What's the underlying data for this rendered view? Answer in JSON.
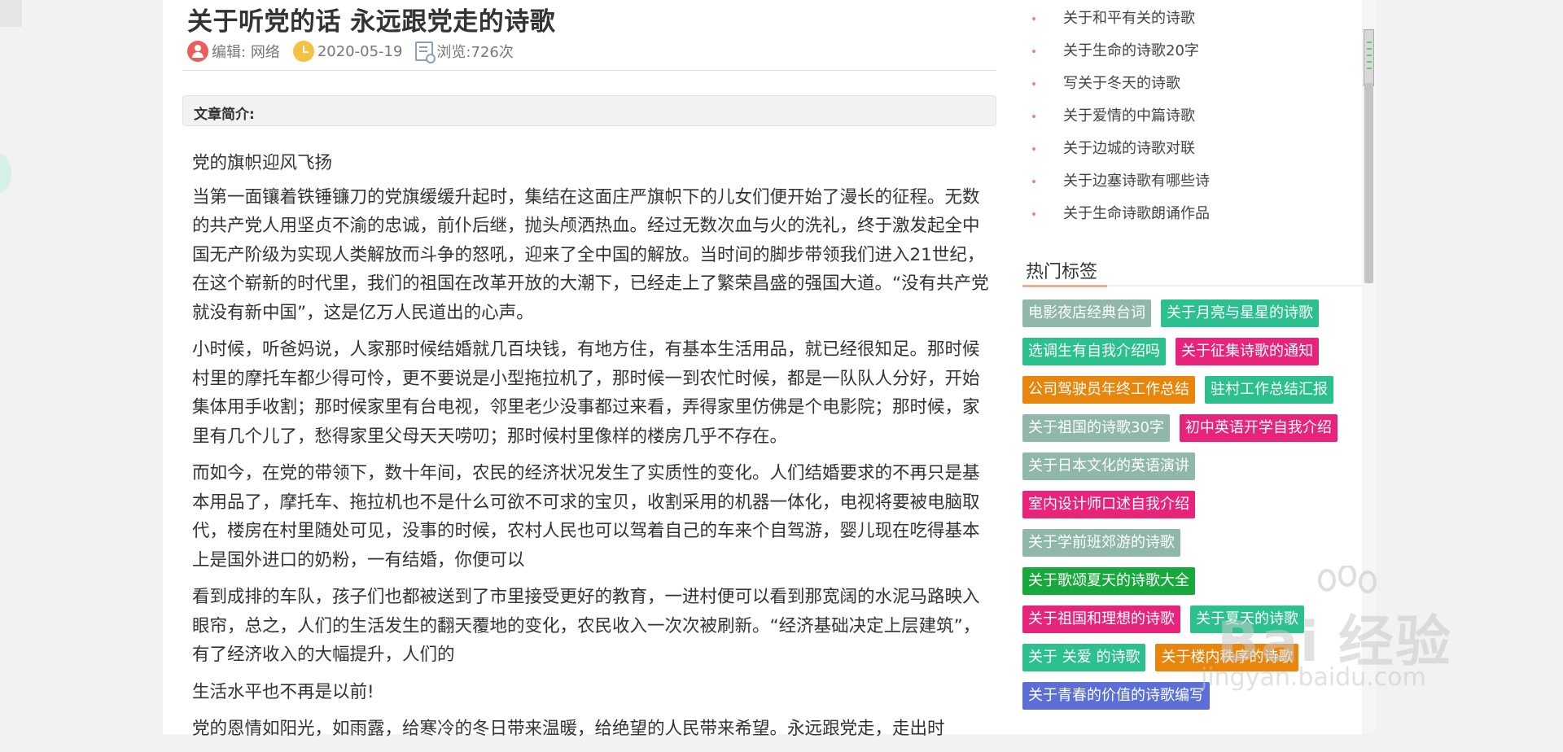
{
  "article": {
    "title": "关于听党的话 永远跟党走的诗歌",
    "editor_label": "编辑:",
    "editor": "网络",
    "date": "2020-05-19",
    "views": "浏览:726次",
    "summary_label": "文章简介:",
    "paragraphs": [
      "党的旗帜迎风飞扬",
      "当第一面镶着铁锤镰刀的党旗缓缓升起时，集结在这面庄严旗帜下的儿女们便开始了漫长的征程。无数的共产党人用坚贞不渝的忠诚，前仆后继，抛头颅洒热血。经过无数次血与火的洗礼，终于激发起全中国无产阶级为实现人类解放而斗争的怒吼，迎来了全中国的解放。当时间的脚步带领我们进入21世纪，在这个崭新的时代里，我们的祖国在改革开放的大潮下，已经走上了繁荣昌盛的强国大道。“没有共产党就没有新中国”，这是亿万人民道出的心声。",
      "小时候，听爸妈说，人家那时候结婚就几百块钱，有地方住，有基本生活用品，就已经很知足。那时候村里的摩托车都少得可怜，更不要说是小型拖拉机了，那时候一到农忙时候，都是一队队人分好，开始集体用手收割；那时候家里有台电视，邻里老少没事都过来看，弄得家里仿佛是个电影院；那时候，家里有几个儿了，愁得家里父母天天唠叨；那时候村里像样的楼房几乎不存在。",
      "而如今，在党的带领下，数十年间，农民的经济状况发生了实质性的变化。人们结婚要求的不再只是基本用品了，摩托车、拖拉机也不是什么可欲不可求的宝贝，收割采用的机器一体化，电视将要被电脑取代，楼房在村里随处可见，没事的时候，农村人民也可以驾着自己的车来个自驾游，婴儿现在吃得基本上是国外进口的奶粉，一有结婚，你便可以",
      "看到成排的车队，孩子们也都被送到了市里接受更好的教育，一进村便可以看到那宽阔的水泥马路映入眼帘，总之，人们的生活发生的翻天覆地的变化，农民收入一次次被刷新。“经济基础决定上层建筑”，有了经济收入的大幅提升，人们的",
      "生活水平也不再是以前!",
      "党的恩情如阳光，如雨露，给寒冷的冬日带来温暖，给绝望的人民带来希望。永远跟党走，走出时"
    ]
  },
  "sidebar": {
    "related": [
      "关于和平有关的诗歌",
      "关于生命的诗歌20字",
      "写关于冬天的诗歌",
      "关于爱情的中篇诗歌",
      "关于边城的诗歌对联",
      "关于边塞诗歌有哪些诗",
      "关于生命诗歌朗诵作品"
    ],
    "hot_tags_title": "热门标签",
    "tag_rows": [
      [
        {
          "label": "电影夜店经典台词",
          "color": "#8fb8a8"
        },
        {
          "label": "关于月亮与星星的诗歌",
          "color": "#2cc08f"
        }
      ],
      [
        {
          "label": "选调生有自我介绍吗",
          "color": "#2cc08f"
        },
        {
          "label": "关于征集诗歌的通知",
          "color": "#e8237a"
        }
      ],
      [
        {
          "label": "公司驾驶员年终工作总结",
          "color": "#e8850c"
        },
        {
          "label": "驻村工作总结汇报",
          "color": "#2cc08f"
        }
      ],
      [
        {
          "label": "关于祖国的诗歌30字",
          "color": "#8fb8a8"
        },
        {
          "label": "初中英语开学自我介绍",
          "color": "#e8237a"
        }
      ],
      [
        {
          "label": "关于日本文化的英语演讲",
          "color": "#8fb8a8"
        }
      ],
      [
        {
          "label": "室内设计师口述自我介绍",
          "color": "#e8237a"
        }
      ],
      [
        {
          "label": "关于学前班郊游的诗歌",
          "color": "#8fb8a8"
        }
      ],
      [
        {
          "label": "关于歌颂夏天的诗歌大全",
          "color": "#19a83c"
        }
      ],
      [
        {
          "label": "关于祖国和理想的诗歌",
          "color": "#e8237a"
        },
        {
          "label": "关于夏天的诗歌",
          "color": "#2cc08f"
        }
      ],
      [
        {
          "label": "关于 关爱 的诗歌",
          "color": "#2cc08f"
        },
        {
          "label": "关于楼内秩序的诗歌",
          "color": "#e8850c"
        }
      ],
      [
        {
          "label": "关于青春的价值的诗歌编写",
          "color": "#5b6fd6"
        }
      ]
    ]
  },
  "watermark": {
    "brand": "Bai",
    "brand2": "经验",
    "url": "jingyan.baidu.com"
  }
}
